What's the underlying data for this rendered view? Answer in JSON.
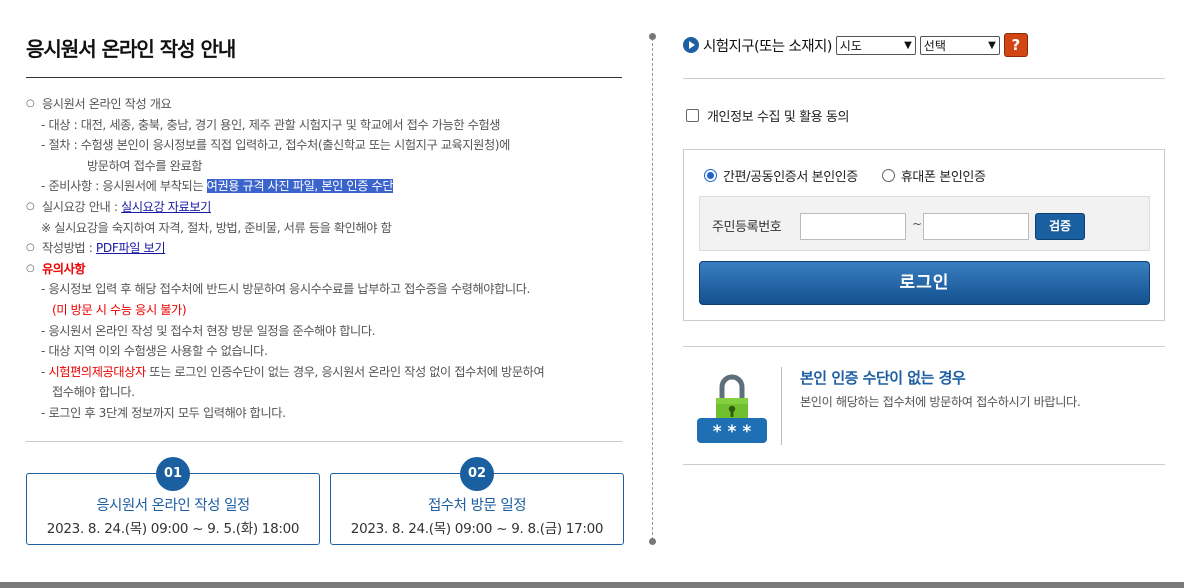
{
  "left": {
    "title": "응시원서 온라인 작성 안내",
    "overview": {
      "heading": "응시원서 온라인 작성 개요",
      "target": "- 대상 : 대전, 세종, 충북, 충남, 경기 용인, 제주 관할 시험지구 및 학교에서 접수 가능한 수험생",
      "proc1": "- 절차 : 수험생 본인이 응시정보를 직접 입력하고, 접수처(출신학교 또는 시험지구 교육지원청)에",
      "proc2": "방문하여 접수를 완료함",
      "prep_prefix": "- 준비사항 : 응시원서에 부착되는 ",
      "prep_highlight": "여권용 규격 사진 파일, 본인 인증 수단"
    },
    "plan": {
      "prefix": "실시요강 안내 : ",
      "link": "실시요강 자료보기",
      "note": "※ 실시요강을 숙지하여 자격, 절차, 방법, 준비물, 서류 등을 확인해야 함"
    },
    "method": {
      "prefix": "작성방법 : ",
      "link": "PDF파일 보기"
    },
    "cautions": {
      "heading": "유의사항",
      "c1": "- 응시정보 입력 후 해당 접수처에 반드시 방문하여 응시수수료를 납부하고 접수증을 수령해야합니다.",
      "c1_red": "(미 방문 시 수능 응시 불가)",
      "c2": "- 응시원서 온라인 작성 및 접수처 현장 방문 일정을 준수해야 합니다.",
      "c3": "- 대상 지역 이외 수험생은 사용할 수 없습니다.",
      "c4_dash": "- ",
      "c4_red": "시험편의제공대상자",
      "c4_rest": " 또는 로그인 인증수단이 없는 경우, 응시원서 온라인 작성 없이 접수처에 방문하여",
      "c4_cont": "접수해야 합니다.",
      "c5": "- 로그인 후 3단계 정보까지 모두 입력해야 합니다."
    },
    "schedules": [
      {
        "num": "01",
        "title": "응시원서 온라인 작성 일정",
        "date": "2023. 8. 24.(목) 09:00 ~ 9. 5.(화) 18:00"
      },
      {
        "num": "02",
        "title": "접수처 방문 일정",
        "date": "2023. 8. 24.(목) 09:00 ~ 9. 8.(금) 17:00"
      }
    ]
  },
  "right": {
    "region_label": "시험지구(또는 소재지)",
    "sido_value": "시도",
    "district_value": "선택",
    "help_label": "?",
    "consent_label": "개인정보 수집 및 활용 동의",
    "auth_options": [
      "간편/공동인증서 본인인증",
      "휴대폰 본인인증"
    ],
    "ssn_label": "주민등록번호",
    "ssn_sep": "~",
    "verify_label": "검증",
    "login_label": "로그인",
    "noauth_title": "본인 인증 수단이 없는 경우",
    "noauth_desc": "본인이 해당하는 접수처에 방문하여 접수하시기 바랍니다.",
    "noauth_icon_text": "* * *"
  },
  "colors": {
    "accent": "#1e5fa3",
    "highlight": "#3a63cc",
    "warning": "#e00000",
    "help": "#d24614"
  }
}
